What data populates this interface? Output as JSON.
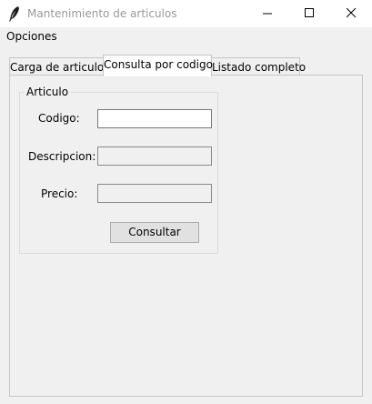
{
  "window": {
    "title": "Mantenimiento de articulos",
    "icon": "feather-icon"
  },
  "menubar": {
    "items": [
      {
        "label": "Opciones"
      }
    ]
  },
  "tabs": [
    {
      "label": "Carga de articulos",
      "active": false
    },
    {
      "label": "Consulta por codigo",
      "active": true
    },
    {
      "label": "Listado completo",
      "active": false
    }
  ],
  "form": {
    "group_label": "Articulo",
    "fields": {
      "codigo": {
        "label": "Codigo:",
        "value": ""
      },
      "descripcion": {
        "label": "Descripcion:",
        "value": ""
      },
      "precio": {
        "label": "Precio:",
        "value": ""
      }
    },
    "submit_label": "Consultar"
  }
}
